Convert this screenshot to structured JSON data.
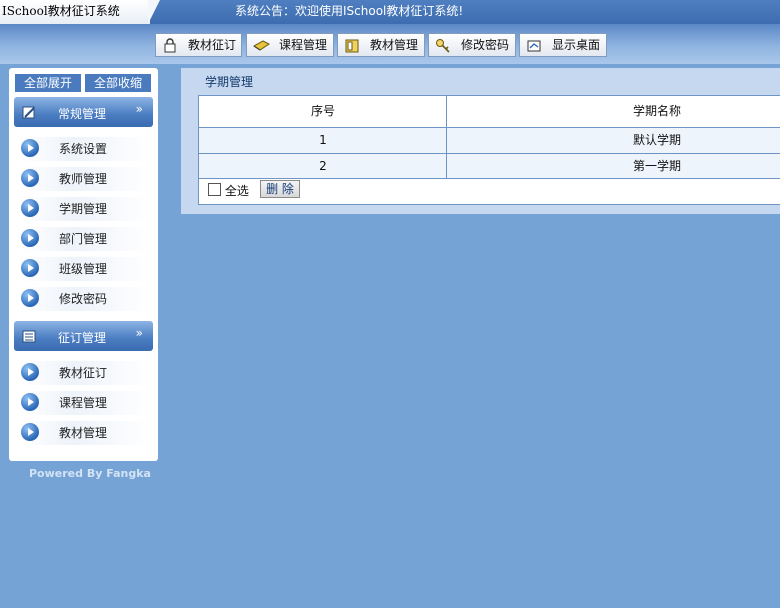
{
  "app": {
    "title": "ISchool教材征订系统",
    "notice": "系统公告：欢迎使用ISchool教材征订系统!"
  },
  "toolbar": {
    "items": [
      {
        "label": "教材征订",
        "icon": "lock-icon"
      },
      {
        "label": "课程管理",
        "icon": "pencil-icon"
      },
      {
        "label": "教材管理",
        "icon": "book-icon"
      },
      {
        "label": "修改密码",
        "icon": "key-icon"
      },
      {
        "label": "显示桌面",
        "icon": "desktop-icon"
      }
    ]
  },
  "sidebar": {
    "expand_all": "全部展开",
    "collapse_all": "全部收缩",
    "groups": [
      {
        "label": "常规管理",
        "chevron": "»",
        "items": [
          {
            "label": "系统设置"
          },
          {
            "label": "教师管理"
          },
          {
            "label": "学期管理"
          },
          {
            "label": "部门管理"
          },
          {
            "label": "班级管理"
          },
          {
            "label": "修改密码"
          }
        ]
      },
      {
        "label": "征订管理",
        "chevron": "»",
        "items": [
          {
            "label": "教材征订"
          },
          {
            "label": "课程管理"
          },
          {
            "label": "教材管理"
          }
        ]
      }
    ],
    "powered": "Powered By Fangka"
  },
  "main": {
    "title": "学期管理",
    "table": {
      "columns": [
        "序号",
        "学期名称"
      ],
      "rows": [
        [
          "1",
          "默认学期"
        ],
        [
          "2",
          "第一学期"
        ]
      ]
    },
    "select_all": "全选",
    "delete_label": "删 除"
  },
  "colors": {
    "background": "#75a3d5",
    "accent": "#4a7bbf",
    "table_border": "#6e95c4"
  }
}
